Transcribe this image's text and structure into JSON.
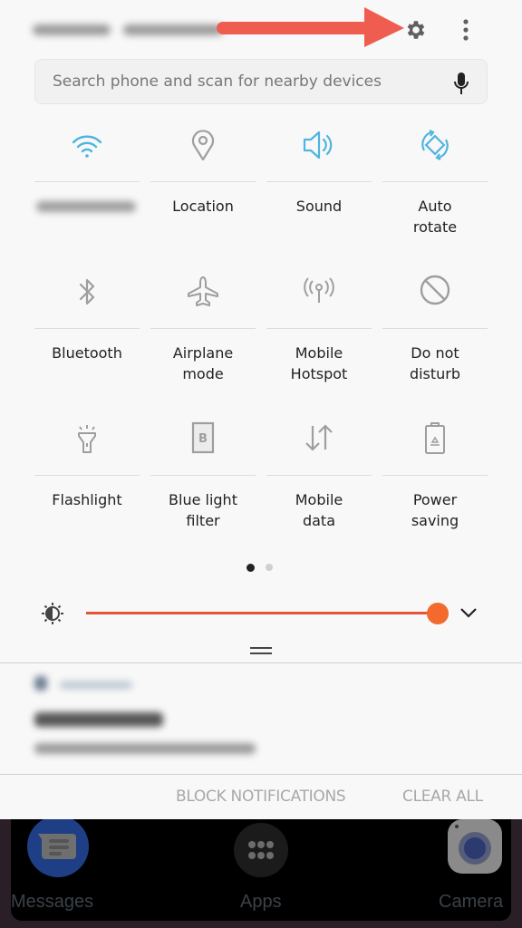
{
  "status_bar": {
    "time_date": "blurred"
  },
  "header": {
    "settings_icon": "gear-icon",
    "more_icon": "more-vertical-icon",
    "annotation": "red-arrow-pointing-to-settings"
  },
  "search": {
    "placeholder": "Search phone and scan for nearby devices",
    "mic_icon": "microphone-icon"
  },
  "quick_settings": {
    "page": 1,
    "page_count": 2,
    "tiles": [
      {
        "label": "",
        "label_blurred": true,
        "icon": "wifi-icon",
        "active": true
      },
      {
        "label": "Location",
        "icon": "location-pin-icon",
        "active": false
      },
      {
        "label": "Sound",
        "icon": "speaker-icon",
        "active": true
      },
      {
        "label": "Auto\nrotate",
        "icon": "auto-rotate-icon",
        "active": true
      },
      {
        "label": "Bluetooth",
        "icon": "bluetooth-icon",
        "active": false
      },
      {
        "label": "Airplane\nmode",
        "icon": "airplane-icon",
        "active": false
      },
      {
        "label": "Mobile\nHotspot",
        "icon": "hotspot-icon",
        "active": false
      },
      {
        "label": "Do not\ndisturb",
        "icon": "do-not-disturb-icon",
        "active": false
      },
      {
        "label": "Flashlight",
        "icon": "flashlight-icon",
        "active": false
      },
      {
        "label": "Blue light\nfilter",
        "icon": "blue-light-filter-icon",
        "active": false
      },
      {
        "label": "Mobile\ndata",
        "icon": "mobile-data-icon",
        "active": false
      },
      {
        "label": "Power\nsaving",
        "icon": "power-saving-icon",
        "active": false
      }
    ]
  },
  "brightness": {
    "icon": "brightness-icon",
    "level_percent": 100,
    "expand_icon": "chevron-down-icon"
  },
  "notification": {
    "app": "blurred",
    "title": "blurred",
    "text": "blurred"
  },
  "notification_actions": {
    "block": "BLOCK NOTIFICATIONS",
    "clear": "CLEAR ALL"
  },
  "dock": {
    "apps": [
      {
        "label": "Messages",
        "icon": "messages-icon"
      },
      {
        "label": "Apps",
        "icon": "apps-grid-icon"
      },
      {
        "label": "Camera",
        "icon": "camera-icon"
      }
    ]
  },
  "colors": {
    "active_icon": "#4fb4e0",
    "inactive_icon": "#9e9e9e",
    "slider": "#e4543c",
    "slider_thumb": "#f26a2e",
    "arrow": "#ee5d4f"
  }
}
